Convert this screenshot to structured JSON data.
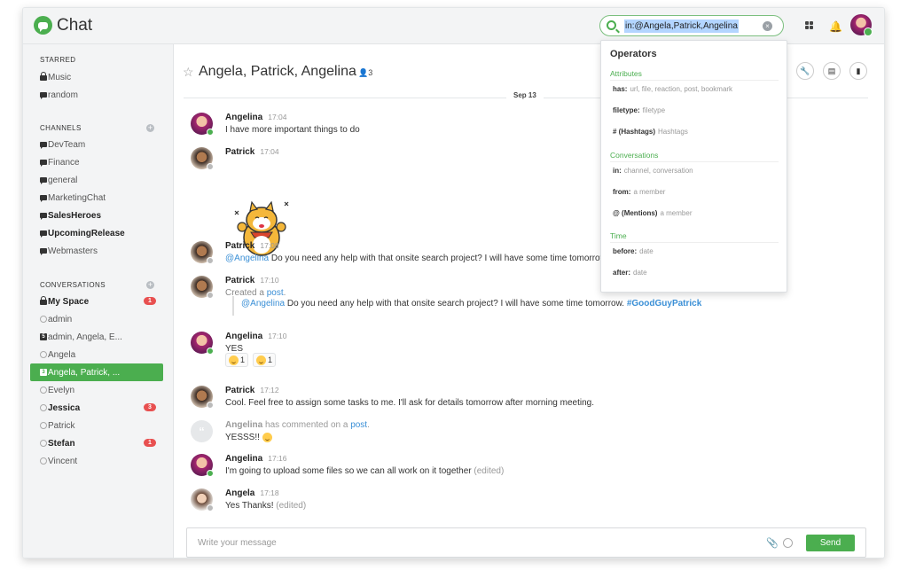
{
  "app": {
    "name": "Chat"
  },
  "search": {
    "query": "in:@Angela,Patrick,Angelina"
  },
  "sidebar": {
    "starred_label": "STARRED",
    "starred": [
      {
        "label": "Music",
        "icon": "lock-icon"
      },
      {
        "label": "random",
        "icon": "chat-bubble-icon"
      }
    ],
    "channels_label": "CHANNELS",
    "channels": [
      {
        "label": "DevTeam",
        "bold": false
      },
      {
        "label": "Finance",
        "bold": false
      },
      {
        "label": "general",
        "bold": false
      },
      {
        "label": "MarketingChat",
        "bold": false
      },
      {
        "label": "SalesHeroes",
        "bold": true
      },
      {
        "label": "UpcomingRelease",
        "bold": true
      },
      {
        "label": "Webmasters",
        "bold": false
      }
    ],
    "conversations_label": "CONVERSATIONS",
    "conversations": [
      {
        "label": "My Space",
        "badge": "1"
      },
      {
        "label": "admin"
      },
      {
        "label": "admin, Angela, E...",
        "icon_text": "5"
      },
      {
        "label": "Angela"
      },
      {
        "label": "Angela, Patrick, ...",
        "icon_text": "3"
      },
      {
        "label": "Evelyn"
      },
      {
        "label": "Jessica",
        "badge": "3"
      },
      {
        "label": "Patrick"
      },
      {
        "label": "Stefan",
        "badge": "1"
      },
      {
        "label": "Vincent"
      }
    ]
  },
  "header": {
    "title": "Angela, Patrick, Angelina",
    "member_count": "3"
  },
  "date_separator": "Sep 13",
  "messages": [
    {
      "author": "Angelina",
      "time": "17:04",
      "text": "I have more important things to do"
    },
    {
      "author": "Patrick",
      "time": "17:04",
      "text": ""
    },
    {
      "author": "Patrick",
      "time": "17:08",
      "mention": "@Angelina",
      "text": " Do you need any help with that onsite search project? I will have some time tomorrow."
    },
    {
      "author": "Patrick",
      "time": "17:10",
      "text": "Created a ",
      "link": "post",
      "end": "."
    },
    {
      "author": "Angelina",
      "time": "17:10",
      "text": "YES"
    },
    {
      "author": "Patrick",
      "time": "17:12",
      "text": "Cool. Feel free to assign some tasks to me. I'll ask for details tomorrow after morning meeting."
    },
    {
      "author": "Angelina",
      "time": "",
      "text": "YESSS!! ",
      "comment_mid": " has commented on a ",
      "link": "post",
      "end": "."
    },
    {
      "author": "Angelina",
      "time": "17:16",
      "text": "I'm going to upload some files so we can all work on it together ",
      "edited": "(edited)"
    },
    {
      "author": "Angela",
      "time": "17:18",
      "text": "Yes Thanks! ",
      "edited": "(edited)"
    }
  ],
  "quoted_post": {
    "mention": "@Angelina",
    "text": " Do you need any help with that onsite search project? I will have some time tomorrow. ",
    "hashtag": "#GoodGuyPatrick"
  },
  "reactions": [
    {
      "count": "1"
    },
    {
      "count": "1"
    }
  ],
  "composer": {
    "placeholder": "Write your message",
    "send_label": "Send"
  },
  "operators": {
    "title": "Operators",
    "groups": [
      {
        "label": "Attributes",
        "items": [
          {
            "key": "has:",
            "desc": "url, file, reaction, post, bookmark"
          },
          {
            "key": "filetype:",
            "desc": "filetype"
          },
          {
            "key": "# (Hashtags)",
            "desc": "Hashtags"
          }
        ]
      },
      {
        "label": "Conversations",
        "items": [
          {
            "key": "in:",
            "desc": "channel, conversation"
          },
          {
            "key": "from:",
            "desc": "a member"
          },
          {
            "key": "@ (Mentions)",
            "desc": "a member"
          }
        ]
      },
      {
        "label": "Time",
        "items": [
          {
            "key": "before:",
            "desc": "date"
          },
          {
            "key": "after:",
            "desc": "date"
          }
        ]
      }
    ]
  },
  "colors": {
    "accent": "#4bae4f",
    "link": "#3a8fd6",
    "badge": "#e85050"
  }
}
